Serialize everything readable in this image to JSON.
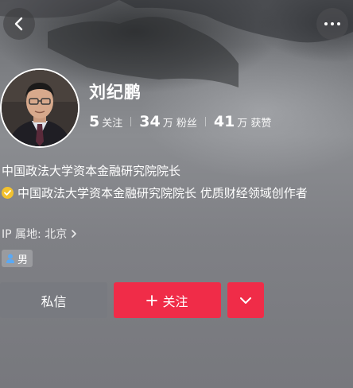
{
  "profile": {
    "name": "刘纪鹏",
    "stats": [
      {
        "value": "5",
        "label": "关注"
      },
      {
        "value": "34",
        "label": "万 粉丝"
      },
      {
        "value": "41",
        "label": "万 获赞"
      }
    ],
    "bio": "中国政法大学资本金融研究院院长",
    "verification": "中国政法大学资本金融研究院院长 优质财经领域创作者",
    "ip_location": "IP 属地: 北京",
    "gender": "男"
  },
  "actions": {
    "message_label": "私信",
    "follow_label": "关注"
  },
  "icons": {
    "back": "chevron-left-icon",
    "more": "more-dots-icon",
    "verified": "verified-badge-icon",
    "ip_chevron": "chevron-right-icon",
    "gender": "male-icon",
    "plus": "plus-icon",
    "dropdown": "chevron-down-icon"
  },
  "colors": {
    "accent": "#f02c48",
    "verified": "#f2c12e",
    "gender_icon": "#5aa9f5"
  }
}
